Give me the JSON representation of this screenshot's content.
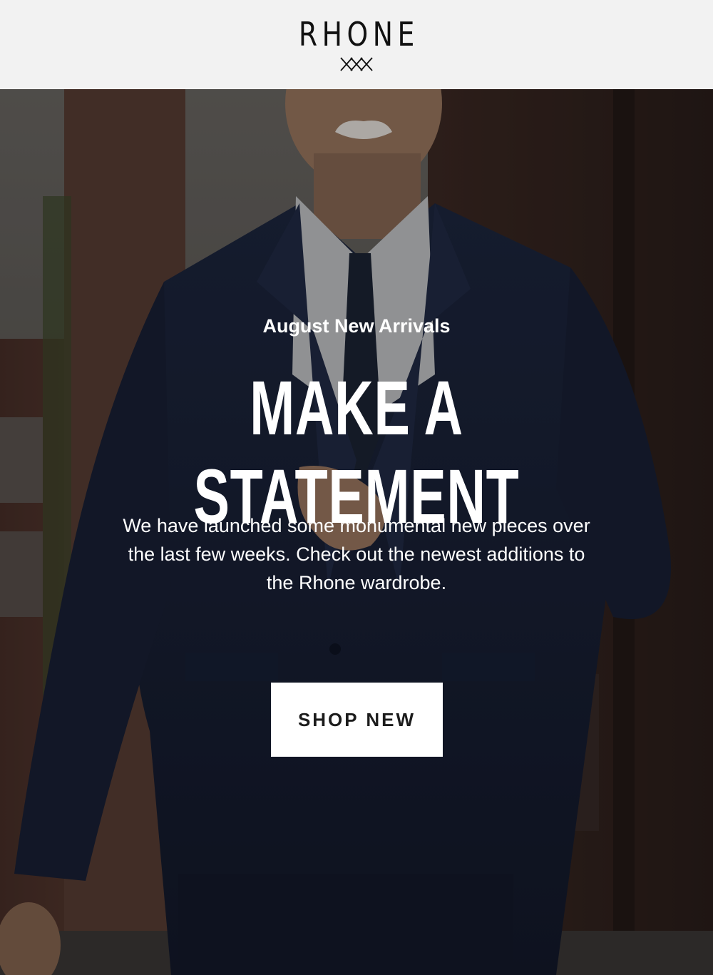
{
  "brand": {
    "logo_text": "RHONE",
    "logo_mark_icon": "crossed-lines-mark-icon"
  },
  "hero": {
    "eyebrow": "August New Arrivals",
    "headline": "MAKE A STATEMENT",
    "body": "We have launched some monumental new pieces over the last few weeks. Check out the newest additions to the Rhone wardrobe.",
    "cta_label": "SHOP NEW",
    "image_subject": "man in navy suit walking on brick street"
  },
  "colors": {
    "header_bg": "#f2f2f2",
    "text_on_hero": "#ffffff",
    "cta_bg": "#ffffff",
    "cta_text": "#1c1c1c",
    "suit_navy": "#1b2238"
  }
}
